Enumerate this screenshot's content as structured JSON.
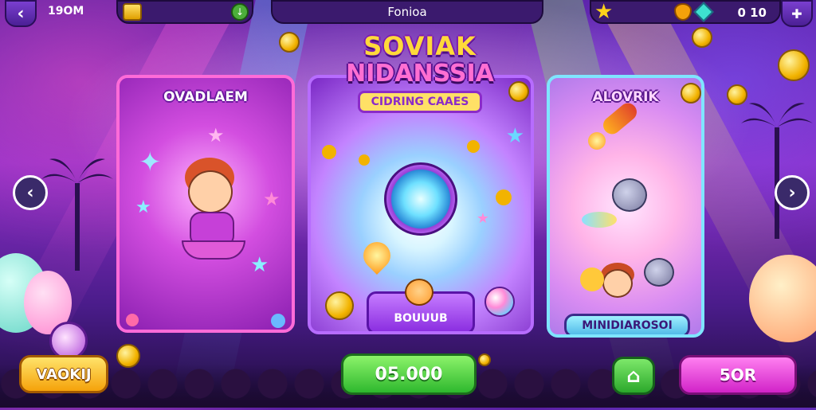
{
  "topbar": {
    "back_icon": "chevron-left-icon",
    "score_label": "19OM",
    "title": "Fonioa",
    "gem_value": "0 10",
    "gift_icon": "gift-icon"
  },
  "logo": {
    "line1": "SOVIAK",
    "line2": "NIDANSSIA",
    "subtitle": "CIDRING CAAES"
  },
  "cards": {
    "left": {
      "title": "OVADLAEM"
    },
    "middle": {
      "badge": "BOUUUB"
    },
    "right": {
      "title": "ALOVRIK",
      "badge": "MINIDIAROSOI"
    }
  },
  "buttons": {
    "left": "VAOKIJ",
    "price": "05.000",
    "right": "5OR"
  },
  "colors": {
    "accent_purple": "#8b2bc8",
    "gold": "#f2b300",
    "green": "#2eb82e",
    "pink": "#d123c8"
  }
}
